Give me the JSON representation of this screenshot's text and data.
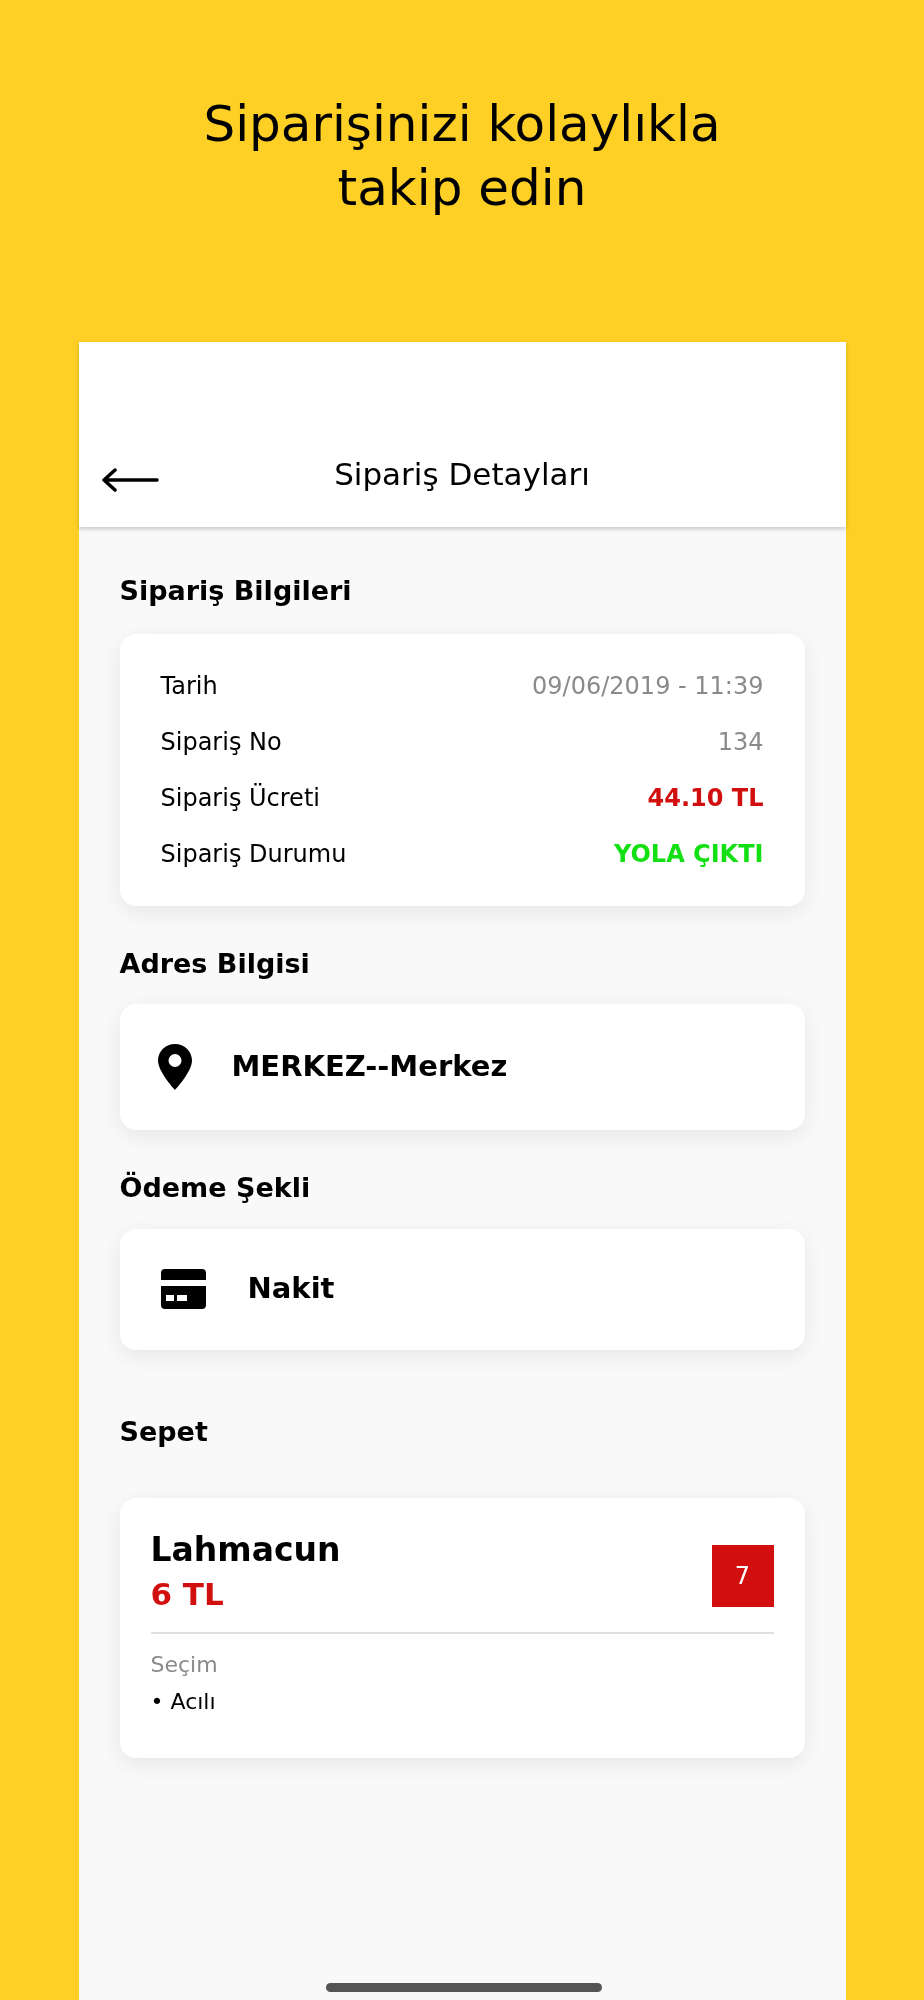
{
  "headline": "Siparişinizi kolaylıkla takip edin",
  "header": {
    "title": "Sipariş Detayları"
  },
  "order_info": {
    "heading": "Sipariş Bilgileri",
    "rows": [
      {
        "label": "Tarih",
        "value": "09/06/2019 - 11:39",
        "kind": "plain"
      },
      {
        "label": "Sipariş No",
        "value": "134",
        "kind": "plain"
      },
      {
        "label": "Sipariş Ücreti",
        "value": "44.10 TL",
        "kind": "price"
      },
      {
        "label": "Sipariş Durumu",
        "value": "YOLA ÇIKTI",
        "kind": "status"
      }
    ]
  },
  "address": {
    "heading": "Adres Bilgisi",
    "text": "MERKEZ--Merkez"
  },
  "payment": {
    "heading": "Ödeme Şekli",
    "text": "Nakit"
  },
  "basket": {
    "heading": "Sepet",
    "items": [
      {
        "product": "Lahmacun",
        "price": "6 TL",
        "quantity": "7",
        "options_label": "Seçim",
        "options": [
          "• Acılı"
        ]
      }
    ]
  }
}
